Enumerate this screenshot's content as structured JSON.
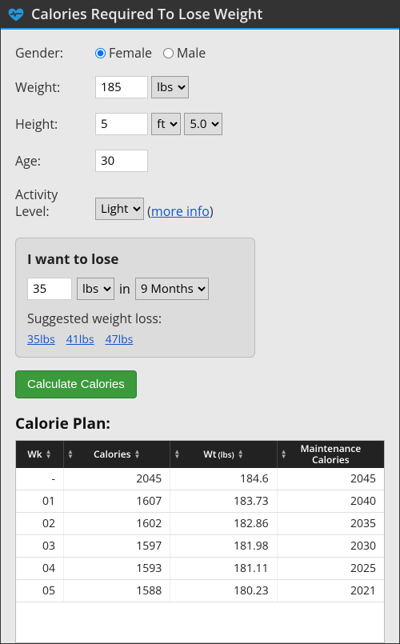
{
  "title": "Calories Required To Lose Weight",
  "form": {
    "gender": {
      "label": "Gender:",
      "options": {
        "female": "Female",
        "male": "Male"
      },
      "selected": "female"
    },
    "weight": {
      "label": "Weight:",
      "value": "185",
      "unit": "lbs"
    },
    "height": {
      "label": "Height:",
      "value": "5",
      "unit": "ft",
      "value2": "5.0"
    },
    "age": {
      "label": "Age:",
      "value": "30"
    },
    "activity": {
      "label": "Activity Level:",
      "value": "Light",
      "more_info": "more info"
    }
  },
  "goal": {
    "title": "I want to lose",
    "amount": "35",
    "unit": "lbs",
    "in": "in",
    "duration": "9 Months",
    "suggest_label": "Suggested weight loss:",
    "suggestions": [
      "35lbs",
      "41lbs",
      "47lbs"
    ]
  },
  "buttons": {
    "calculate": "Calculate Calories"
  },
  "plan": {
    "heading": "Calorie Plan:",
    "columns": {
      "wk": "Wk",
      "calories": "Calories",
      "wt": "Wt",
      "wt_unit": "(lbs)",
      "maint": "Maintenance Calories"
    },
    "rows": [
      {
        "wk": "-",
        "cal": "2045",
        "wt": "184.6",
        "maint": "2045"
      },
      {
        "wk": "01",
        "cal": "1607",
        "wt": "183.73",
        "maint": "2040"
      },
      {
        "wk": "02",
        "cal": "1602",
        "wt": "182.86",
        "maint": "2035"
      },
      {
        "wk": "03",
        "cal": "1597",
        "wt": "181.98",
        "maint": "2030"
      },
      {
        "wk": "04",
        "cal": "1593",
        "wt": "181.11",
        "maint": "2025"
      },
      {
        "wk": "05",
        "cal": "1588",
        "wt": "180.23",
        "maint": "2021"
      }
    ]
  }
}
